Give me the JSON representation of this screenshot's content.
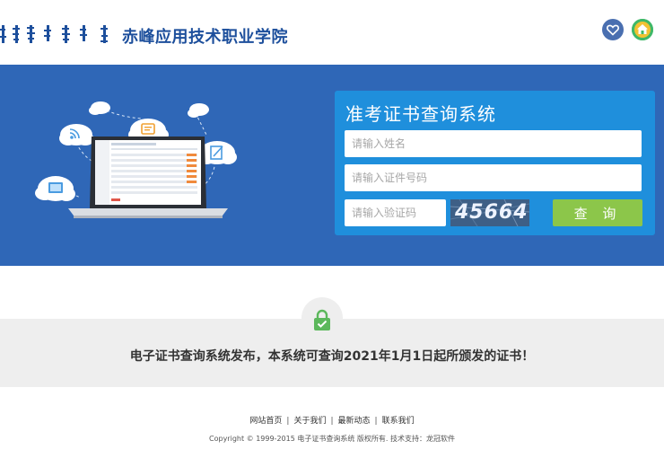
{
  "header": {
    "school_name": "赤峰应用技术职业学院",
    "icons": [
      "heart-icon",
      "home-icon"
    ]
  },
  "query_panel": {
    "title": "准考证书查询系统",
    "name_placeholder": "请输入姓名",
    "id_placeholder": "请输入证件号码",
    "code_placeholder": "请输入验证码",
    "captcha": "45664",
    "submit_label": "查 询"
  },
  "notice": {
    "text": "电子证书查询系统发布，本系统可查询2021年1月1日起所颁发的证书！"
  },
  "footer": {
    "links": [
      "网站首页",
      "关于我们",
      "最新动态",
      "联系我们"
    ],
    "separator": "|",
    "copyright": "Copyright © 1999-2015 电子证书查询系统 版权所有. 技术支持：龙冠软件"
  },
  "colors": {
    "banner": "#2f67b7",
    "panel": "#1f8fdc",
    "button": "#8cc64a",
    "brand_text": "#1d4f9c"
  }
}
